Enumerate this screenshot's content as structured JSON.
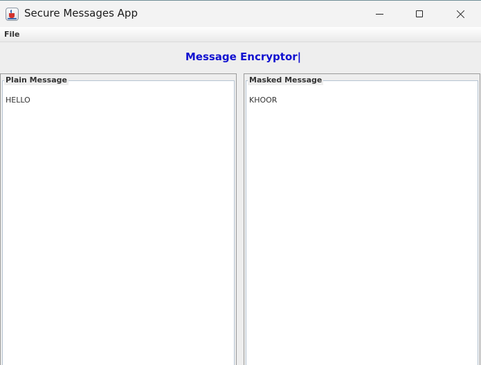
{
  "window": {
    "title": "Secure Messages App",
    "icon": "java-cup-icon",
    "controls": {
      "minimize": "minimize-icon",
      "maximize": "maximize-icon",
      "close": "close-icon"
    }
  },
  "menubar": {
    "items": [
      {
        "label": "File"
      }
    ]
  },
  "heading": {
    "text": "Message Encryptor|",
    "color": "#1010d0"
  },
  "panels": {
    "plain": {
      "title": "Plain Message",
      "content": "HELLO"
    },
    "masked": {
      "title": "Masked Message",
      "content": "KHOOR"
    }
  }
}
